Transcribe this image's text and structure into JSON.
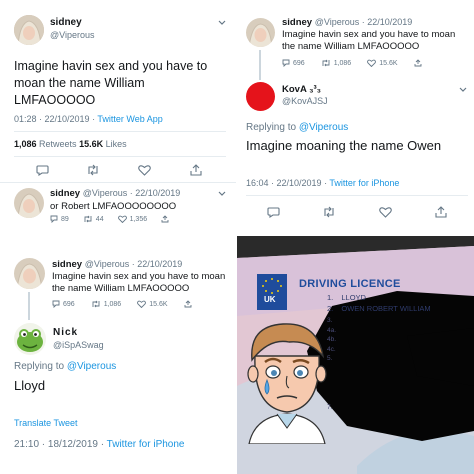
{
  "colors": {
    "twitter_blue": "#1b95e0",
    "text": "#14171a",
    "muted": "#657786",
    "heart_red": "#e0245e"
  },
  "panel_a": {
    "main": {
      "name": "sidney",
      "handle": "@Viperous",
      "text": "Imagine havin sex and you have to moan the name William LMFAOOOOO",
      "time": "01:28 · 22/10/2019 · ",
      "source": "Twitter Web App",
      "retweets": "1,086",
      "retweets_label": " Retweets ",
      "likes": "15.6K",
      "likes_label": " Likes"
    },
    "reply": {
      "name": "sidney",
      "handle": "@Viperous · 22/10/2019",
      "text": "or Robert LMFAOOOOOOOO",
      "replies": "89",
      "retweets": "44",
      "likes": "1,356"
    }
  },
  "panel_b": {
    "quoted": {
      "name": "sidney",
      "handle": "@Viperous · 22/10/2019",
      "text": "Imagine havin sex and you have to moan the name William LMFAOOOOO",
      "replies": "696",
      "retweets": "1,086",
      "likes": "15.6K"
    },
    "main": {
      "name": "KovA ₃³₃",
      "handle": "@KovAJSJ",
      "replying_prefix": "Replying to ",
      "replying_to": "@Viperous",
      "text": "Imagine moaning the name Owen",
      "time": "16:04 · 22/10/2019 · ",
      "source": "Twitter for iPhone"
    }
  },
  "panel_c": {
    "quoted": {
      "name": "sidney",
      "handle": "@Viperous · 22/10/2019",
      "text": "Imagine havin sex and you have to moan the name William LMFAOOOOO",
      "replies": "696",
      "retweets": "1,086",
      "likes": "15.6K"
    },
    "main": {
      "name": "Nick",
      "handle": "@iSpASwag",
      "replying_prefix": "Replying to ",
      "replying_to": "@Viperous",
      "text": "Lloyd",
      "translate": "Translate Tweet",
      "time": "21:10 · 18/12/2019 · ",
      "source": "Twitter for iPhone"
    }
  },
  "panel_d": {
    "licence_title": "DRIVING LICENCE",
    "uk": "UK",
    "line1_num": "1.",
    "line1": "LLOYD",
    "line2_num": "2.",
    "line2": "OWEN ROBERT WILLIAM",
    "line3_num": "3.",
    "line4a_num": "4a.",
    "line4b_num": "4b.",
    "line4c_num": "4c.",
    "line5_num": "5.",
    "line7_num": "7."
  }
}
